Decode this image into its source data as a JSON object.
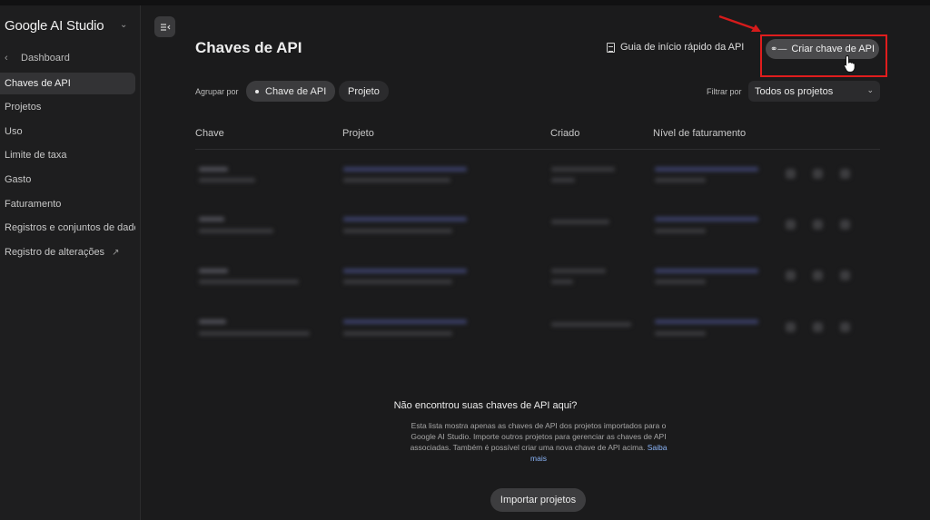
{
  "sidebar": {
    "brand": "Google AI Studio",
    "back_label": "Dashboard",
    "items": [
      {
        "label": "Chaves de API",
        "active": true
      },
      {
        "label": "Projetos"
      },
      {
        "label": "Uso"
      },
      {
        "label": "Limite de taxa"
      },
      {
        "label": "Gasto"
      },
      {
        "label": "Faturamento"
      },
      {
        "label": "Registros e conjuntos de dados"
      },
      {
        "label": "Registro de alterações",
        "external": true
      }
    ]
  },
  "header": {
    "title": "Chaves de API",
    "guide_link": "Guia de início rápido da API",
    "create_button": "Criar chave de API"
  },
  "toolbar": {
    "group_label": "Agrupar por",
    "group_options": [
      "Chave de API",
      "Projeto"
    ],
    "filter_label": "Filtrar por",
    "filter_value": "Todos os projetos"
  },
  "table": {
    "columns": [
      "Chave",
      "Projeto",
      "Criado",
      "Nível de faturamento"
    ]
  },
  "empty_state": {
    "title": "Não encontrou suas chaves de API aqui?",
    "description": "Esta lista mostra apenas as chaves de API dos projetos importados para o Google AI Studio. Importe outros projetos para gerenciar as chaves de API associadas. Também é possível criar uma nova chave de API acima.",
    "learn_more": "Saiba mais",
    "import_button": "Importar projetos"
  },
  "colors": {
    "background": "#1b1b1c",
    "highlight": "#e01d1d",
    "link": "#8ab4f8"
  }
}
